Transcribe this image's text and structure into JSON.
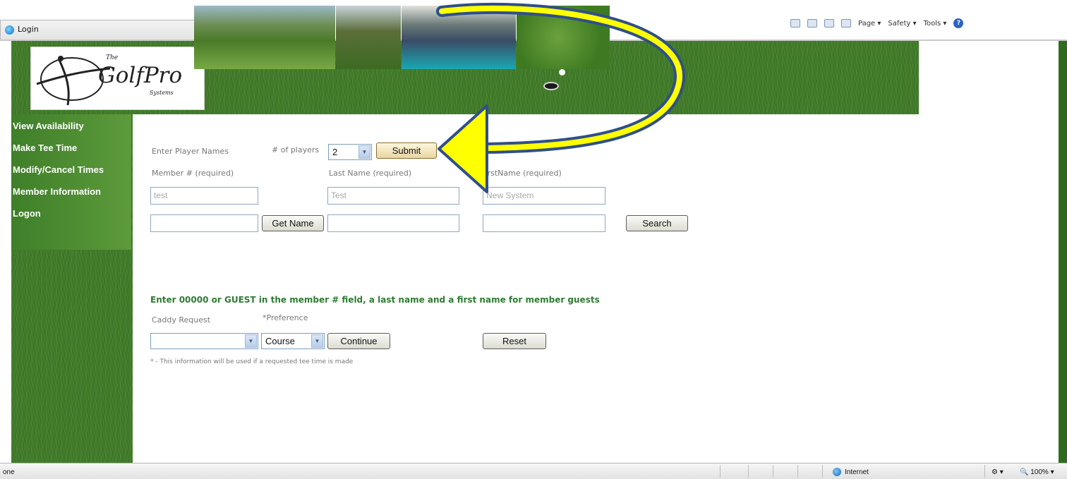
{
  "browser": {
    "tab_title": "Login",
    "command_bar": {
      "page": "Page ▾",
      "safety": "Safety ▾",
      "tools": "Tools ▾",
      "help": "?"
    }
  },
  "banner": {
    "logo_the": "The",
    "logo_text": "GolfPro",
    "logo_systems": "Systems"
  },
  "sidebar": {
    "items": [
      {
        "label": "View Availability"
      },
      {
        "label": "Make Tee Time"
      },
      {
        "label": "Modify/Cancel Times"
      },
      {
        "label": "Member Information"
      },
      {
        "label": "Logon"
      }
    ]
  },
  "form": {
    "enter_player_names": "Enter Player Names",
    "num_players_label": "# of players",
    "num_players_value": "2",
    "submit_label": "Submit",
    "member_label": "Member # (required)",
    "last_name_label": "Last Name (required)",
    "first_name_label": "FirstName (required)",
    "row1": {
      "member": "test",
      "last": "Test",
      "first": "New System"
    },
    "row2": {
      "member": "",
      "last": "",
      "first": ""
    },
    "get_name_label": "Get Name",
    "search_label": "Search",
    "notice": "Enter 00000 or GUEST in the member # field, a last name and a first name for member guests",
    "caddy_label": "Caddy Request",
    "preference_label": "*Preference",
    "caddy_value": "",
    "preference_value": "Course",
    "continue_label": "Continue",
    "reset_label": "Reset",
    "footnote": "* - This information will be used if a requested tee time is made"
  },
  "statusbar": {
    "left": "one",
    "zone": "Internet",
    "zoom": "100%"
  },
  "annotation": {
    "arrow_color": "#ffff00",
    "outline_color": "#2f4f8a"
  }
}
